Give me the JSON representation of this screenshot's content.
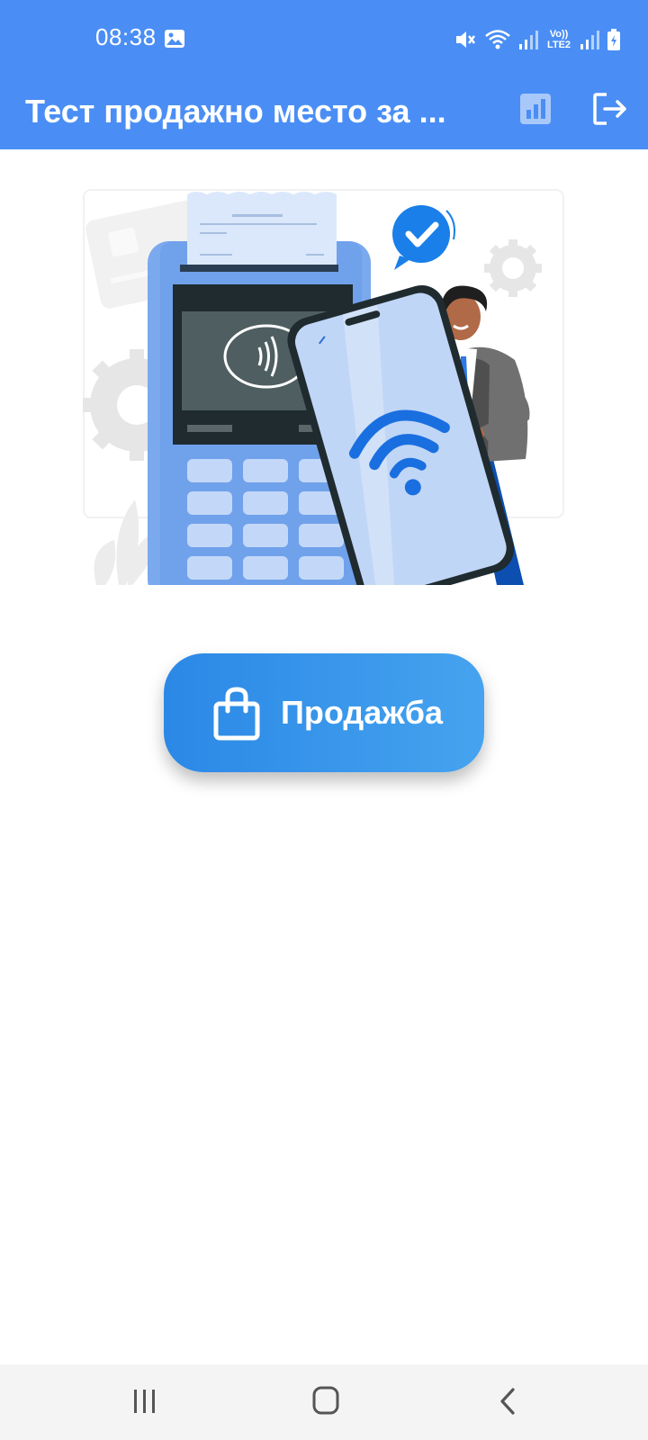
{
  "status_bar": {
    "time": "08:38",
    "icons": [
      "gallery-icon",
      "mute-icon",
      "wifi-icon",
      "signal-icon",
      "volte-lte2-icon",
      "signal-icon",
      "battery-charging-icon"
    ],
    "volte_label": "Vo)) LTE2"
  },
  "app_bar": {
    "title": "Тест продажно место за ...",
    "actions": [
      "bar-chart-icon",
      "logout-icon"
    ]
  },
  "main": {
    "illustration": "contactless-payment-illustration",
    "sale_button": {
      "label": "Продажба",
      "icon": "shopping-bag-icon"
    }
  },
  "nav_bar": {
    "buttons": [
      "recents-icon",
      "home-icon",
      "back-icon"
    ]
  },
  "colors": {
    "primary": "#4a8ef5",
    "button_start": "#2b88e6",
    "button_end": "#45a3ef",
    "nav_bg": "#f4f4f4"
  }
}
